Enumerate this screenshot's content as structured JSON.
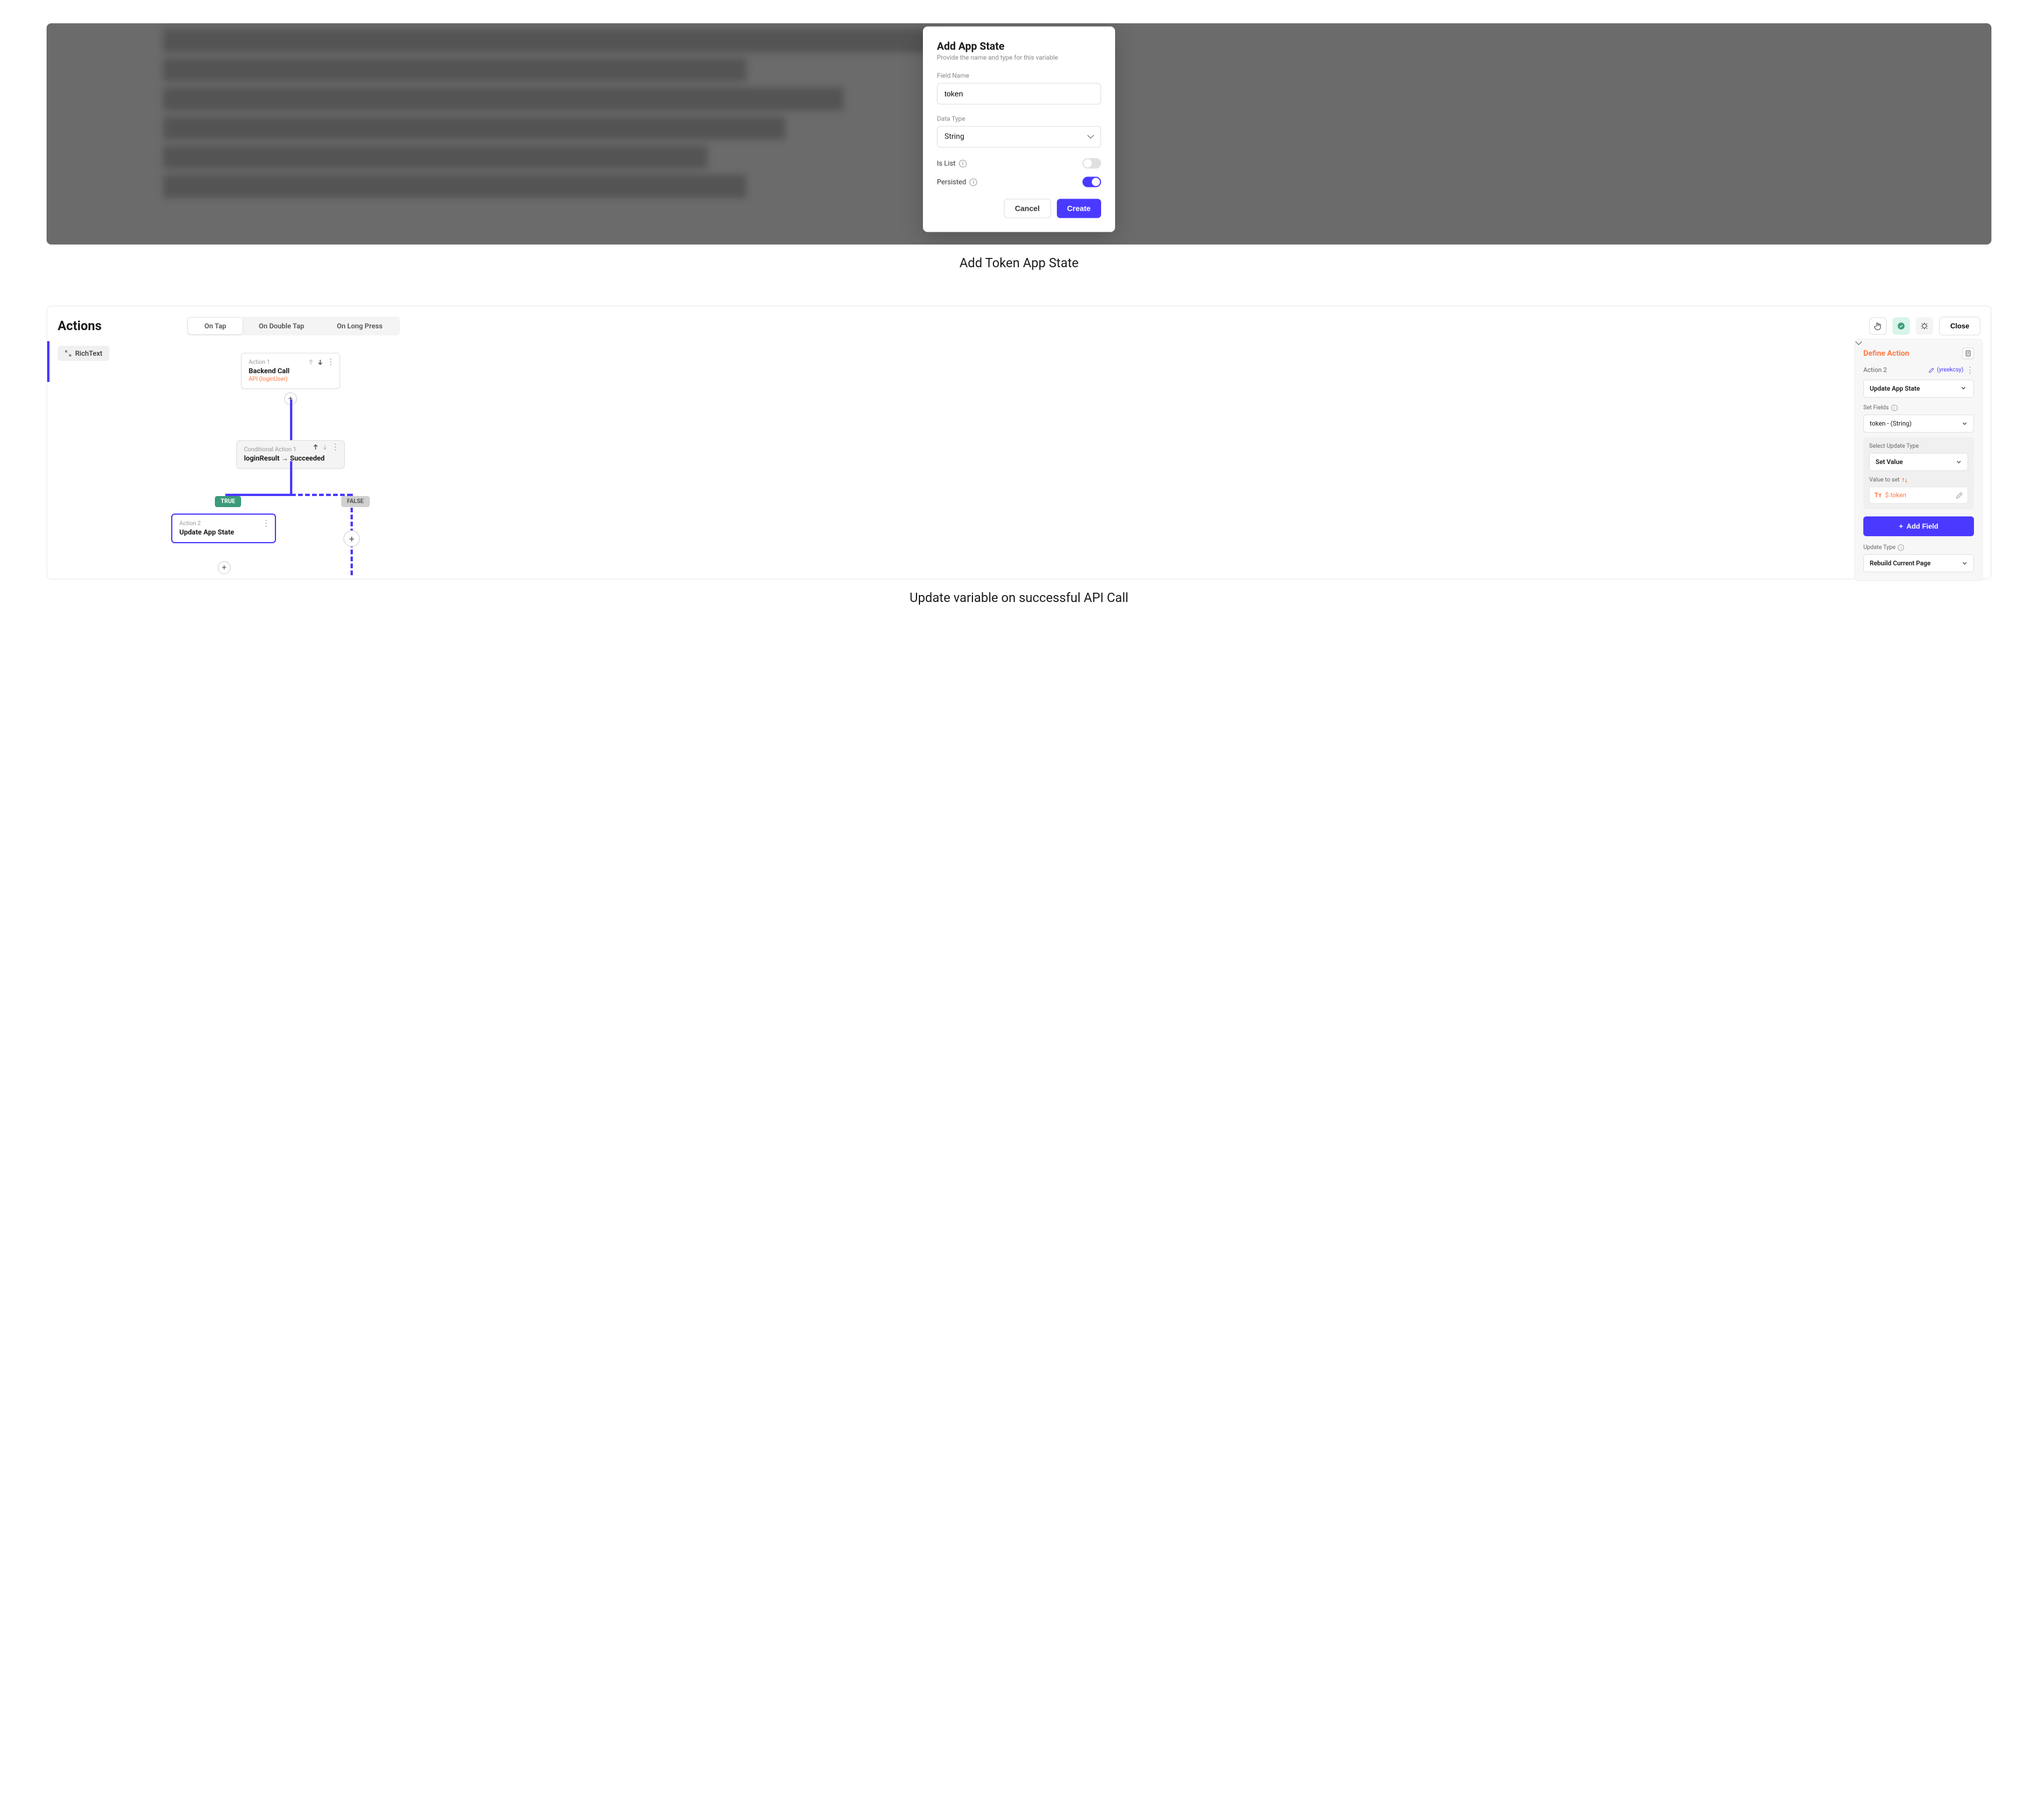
{
  "section1": {
    "caption": "Add Token App State",
    "modal": {
      "title": "Add App State",
      "subtitle": "Provide the name and type for this variable",
      "field_name_label": "Field Name",
      "field_name_value": "token",
      "data_type_label": "Data Type",
      "data_type_value": "String",
      "is_list_label": "Is List",
      "persisted_label": "Persisted",
      "cancel": "Cancel",
      "create": "Create"
    }
  },
  "section2": {
    "caption": "Update variable on successful API Call",
    "title": "Actions",
    "tabs": {
      "on_tap": "On Tap",
      "on_double_tap": "On Double Tap",
      "on_long_press": "On Long Press"
    },
    "close": "Close",
    "richtext_chip": "RichText",
    "flow": {
      "action1_label": "Action 1",
      "action1_title": "Backend Call",
      "action1_sub": "API (loginUser)",
      "cond_label": "Conditional Action 1",
      "cond_title": "loginResult → Succeeded",
      "true_badge": "TRUE",
      "false_badge": "FALSE",
      "action2_label": "Action 2",
      "action2_title": "Update App State"
    },
    "panel": {
      "title": "Define Action",
      "action_label": "Action 2",
      "hash": "(yreekcsy)",
      "action_select": "Update App State",
      "set_fields_label": "Set Fields",
      "field_select": "token - (String)",
      "update_type_label": "Select Update Type",
      "update_type_value": "Set Value",
      "value_to_set_label": "Value to set",
      "value_token": "$.token",
      "add_field": "Add Field",
      "update_type2_label": "Update Type",
      "update_type2_value": "Rebuild Current Page"
    }
  }
}
